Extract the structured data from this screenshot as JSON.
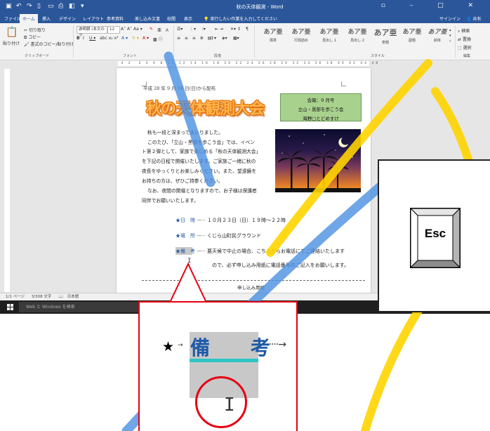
{
  "window": {
    "title": "秋の天体観測 - Word",
    "controls": [
      "▫",
      "–",
      "□",
      "✕"
    ]
  },
  "tabs": [
    "ファイル",
    "ホーム",
    "挿入",
    "デザイン",
    "レイアウト",
    "参考資料",
    "差し込み文書",
    "校閲",
    "表示"
  ],
  "tell_me": "実行したい作業を入力してください",
  "account": {
    "signin": "サインイン",
    "share": "共有"
  },
  "ribbon": {
    "clipboard": {
      "paste": "貼り付け",
      "cut": "切り取り",
      "copy": "コピー",
      "format_painter": "書式のコピー/貼り付け",
      "label": "クリップボード"
    },
    "font": {
      "name": "游明朝 (本文のフ",
      "size": "12",
      "label": "フォント"
    },
    "paragraph": {
      "label": "段落"
    },
    "styles": {
      "items": [
        {
          "preview": "あア亜",
          "name": "標準"
        },
        {
          "preview": "あア亜",
          "name": "行間詰め"
        },
        {
          "preview": "あア亜",
          "name": "見出し 1"
        },
        {
          "preview": "あア亜",
          "name": "見出し 2"
        },
        {
          "preview": "あア亜",
          "name": "表題"
        },
        {
          "preview": "あア亜",
          "name": "副題"
        },
        {
          "preview": "あア亜",
          "name": "斜体"
        }
      ],
      "label": "スタイル"
    },
    "editing": {
      "find": "検索",
      "replace": "置換",
      "select": "選択",
      "label": "編集"
    }
  },
  "document": {
    "date_line": "平成 28 年 9 月 18 日(日)から配布",
    "heading": "秋の天体観測大会",
    "bulletin": [
      "会報：9 月号",
      "立山・黒部を歩こう会",
      "海野□とどめすけ"
    ],
    "paragraphs": [
      "秋も一段と深まってまいりました。",
      "このたび、「立山・黒部を歩こう会」では、イベン",
      "ト第２弾として、家族で楽しめる「秋の天体観測大会」",
      "を下記の日程で開催いたします。ご家族ご一緒に秋の",
      "夜長をゆっくりとお楽しみください。また、望遠鏡を",
      "お持ちの方は、ぜひご持参ください。",
      "なお、夜間の開催となりますので、お子様は保護者",
      "同伴でお願いいたします。"
    ],
    "events": [
      {
        "mark": "★日　時",
        "text": "１０月２３日（日）１９時〜２２時"
      },
      {
        "mark": "★場　所",
        "text": "くじら山町民グラウンド"
      },
      {
        "mark": "★備　考",
        "text": "悪天候で中止の場合、こちらからお電話にてご連絡いたします"
      }
    ],
    "event_continuation": "ので、必ず申し込み用紙に電話番号のご記入をお願いします。",
    "footer": "申し込み用紙"
  },
  "status": {
    "page": "1/1 ページ",
    "words": "3/308 文字",
    "language": "日本語"
  },
  "taskbar": {
    "search_placeholder": "Web と Windows を検索"
  },
  "key": {
    "label": "Esc"
  },
  "zoom": {
    "star": "★",
    "word": "備 考"
  },
  "colors": {
    "word_blue": "#2b579a",
    "callout_red": "#e60012",
    "highlight": "#c8c8c8",
    "underline_teal": "#2ec4c4"
  }
}
